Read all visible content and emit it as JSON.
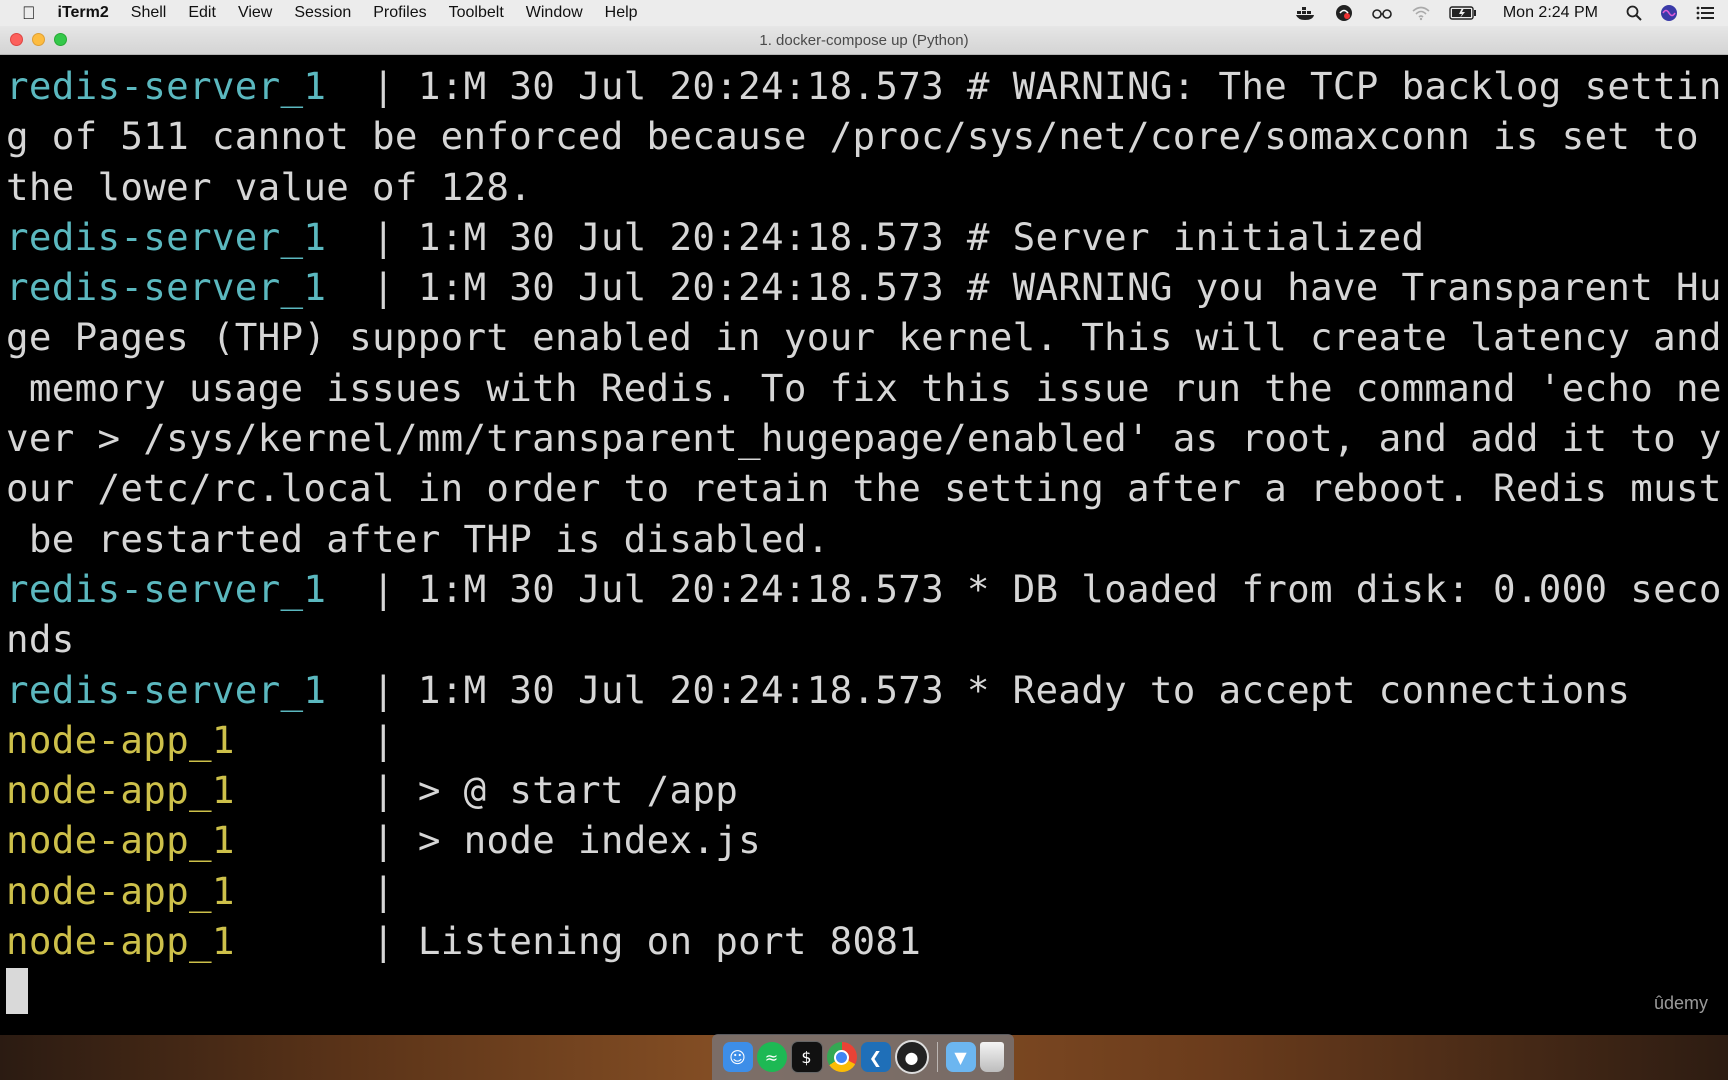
{
  "menubar": {
    "app_name": "iTerm2",
    "items": [
      "Shell",
      "Edit",
      "View",
      "Session",
      "Profiles",
      "Toolbelt",
      "Window",
      "Help"
    ],
    "status_icons": [
      "docker-icon",
      "creative-cloud-icon",
      "glasses-icon",
      "wifi-icon",
      "battery-icon"
    ],
    "clock": "Mon 2:24 PM"
  },
  "window": {
    "title": "1. docker-compose up (Python)"
  },
  "terminal": {
    "lines": [
      {
        "service": "redis-server_1",
        "gap": "  ",
        "sep": "| ",
        "text": "1:M 30 Jul 20:24:18.573 # WARNING: The TCP backlog settin"
      },
      {
        "service": "",
        "gap": "",
        "sep": "",
        "text": "g of 511 cannot be enforced because /proc/sys/net/core/somaxconn is set to"
      },
      {
        "service": "",
        "gap": "",
        "sep": "",
        "text": "the lower value of 128."
      },
      {
        "service": "redis-server_1",
        "gap": "  ",
        "sep": "| ",
        "text": "1:M 30 Jul 20:24:18.573 # Server initialized"
      },
      {
        "service": "redis-server_1",
        "gap": "  ",
        "sep": "| ",
        "text": "1:M 30 Jul 20:24:18.573 # WARNING you have Transparent Hu"
      },
      {
        "service": "",
        "gap": "",
        "sep": "",
        "text": "ge Pages (THP) support enabled in your kernel. This will create latency and"
      },
      {
        "service": "",
        "gap": "",
        "sep": "",
        "text": " memory usage issues with Redis. To fix this issue run the command 'echo ne"
      },
      {
        "service": "",
        "gap": "",
        "sep": "",
        "text": "ver > /sys/kernel/mm/transparent_hugepage/enabled' as root, and add it to y"
      },
      {
        "service": "",
        "gap": "",
        "sep": "",
        "text": "our /etc/rc.local in order to retain the setting after a reboot. Redis must"
      },
      {
        "service": "",
        "gap": "",
        "sep": "",
        "text": " be restarted after THP is disabled."
      },
      {
        "service": "redis-server_1",
        "gap": "  ",
        "sep": "| ",
        "text": "1:M 30 Jul 20:24:18.573 * DB loaded from disk: 0.000 seco"
      },
      {
        "service": "",
        "gap": "",
        "sep": "",
        "text": "nds"
      },
      {
        "service": "redis-server_1",
        "gap": "  ",
        "sep": "| ",
        "text": "1:M 30 Jul 20:24:18.573 * Ready to accept connections"
      },
      {
        "service": "node-app_1",
        "gap": "      ",
        "sep": "|",
        "text": ""
      },
      {
        "service": "node-app_1",
        "gap": "      ",
        "sep": "| ",
        "text": "> @ start /app"
      },
      {
        "service": "node-app_1",
        "gap": "      ",
        "sep": "| ",
        "text": "> node index.js"
      },
      {
        "service": "node-app_1",
        "gap": "      ",
        "sep": "|",
        "text": ""
      },
      {
        "service": "node-app_1",
        "gap": "      ",
        "sep": "| ",
        "text": "Listening on port 8081"
      }
    ],
    "watermark": "ûdemy"
  },
  "colors": {
    "redis_service": "#5bb8bf",
    "node_service": "#cdc04a",
    "terminal_text": "#d6d6d6",
    "terminal_bg": "#000000"
  },
  "dock": {
    "apps": [
      "finder-icon",
      "spotify-icon",
      "terminal-icon",
      "chrome-icon",
      "vscode-icon",
      "obs-icon",
      "folder-icon",
      "trash-icon"
    ]
  }
}
